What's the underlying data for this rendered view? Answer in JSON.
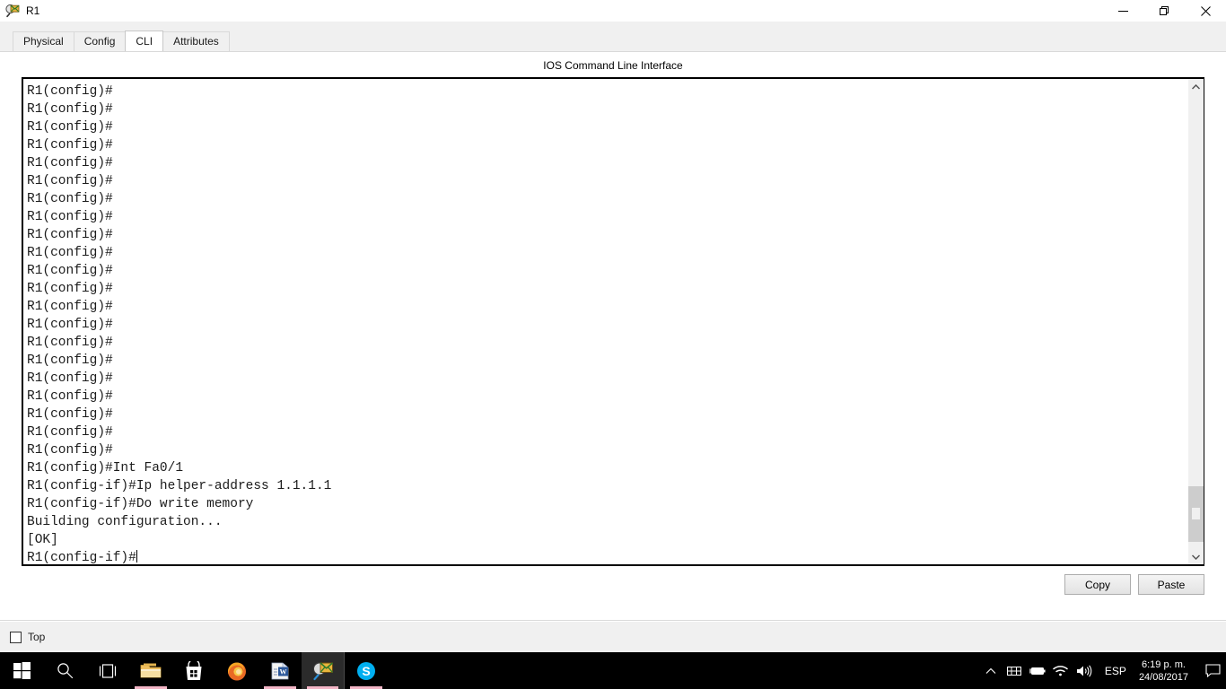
{
  "window": {
    "title": "R1",
    "icon": "packet-tracer-icon",
    "controls": {
      "minimize": "minimize-icon",
      "maximize": "restore-icon",
      "close": "close-icon"
    }
  },
  "tabs": [
    {
      "label": "Physical",
      "active": false
    },
    {
      "label": "Config",
      "active": false
    },
    {
      "label": "CLI",
      "active": true
    },
    {
      "label": "Attributes",
      "active": false
    }
  ],
  "cli": {
    "header": "IOS Command Line Interface",
    "lines": [
      "R1(config)#",
      "R1(config)#",
      "R1(config)#",
      "R1(config)#",
      "R1(config)#",
      "R1(config)#",
      "R1(config)#",
      "R1(config)#",
      "R1(config)#",
      "R1(config)#",
      "R1(config)#",
      "R1(config)#",
      "R1(config)#",
      "R1(config)#",
      "R1(config)#",
      "R1(config)#",
      "R1(config)#",
      "R1(config)#",
      "R1(config)#",
      "R1(config)#",
      "R1(config)#",
      "R1(config)#Int Fa0/1",
      "R1(config-if)#Ip helper-address 1.1.1.1",
      "R1(config-if)#Do write memory",
      "Building configuration...",
      "[OK]"
    ],
    "prompt": "R1(config-if)#",
    "text_color": "#1c1c1c",
    "background": "#ffffff"
  },
  "scrollbar": {
    "up_icon": "chevron-up-icon",
    "down_icon": "chevron-down-icon",
    "thumb_color": "#cdcdcd",
    "track_color": "#f0f0f0"
  },
  "buttons": {
    "copy": "Copy",
    "paste": "Paste"
  },
  "options": {
    "top_label": "Top",
    "top_checked": false
  },
  "taskbar": {
    "items": [
      {
        "name": "start-button",
        "icon": "windows-logo-icon",
        "active": false,
        "underline": false
      },
      {
        "name": "search-button",
        "icon": "search-icon",
        "active": false,
        "underline": false
      },
      {
        "name": "task-view-button",
        "icon": "task-view-icon",
        "active": false,
        "underline": false
      },
      {
        "name": "file-explorer-button",
        "icon": "folder-icon",
        "active": false,
        "underline": true
      },
      {
        "name": "microsoft-store-button",
        "icon": "store-bag-icon",
        "active": false,
        "underline": false
      },
      {
        "name": "firefox-button",
        "icon": "firefox-icon",
        "active": false,
        "underline": false
      },
      {
        "name": "word-button",
        "icon": "word-document-icon",
        "active": false,
        "underline": true
      },
      {
        "name": "packet-tracer-button",
        "icon": "packet-tracer-icon",
        "active": true,
        "underline": true
      },
      {
        "name": "skype-button",
        "icon": "skype-icon",
        "active": false,
        "underline": true
      }
    ],
    "tray": {
      "show_hidden": "chevron-up-icon",
      "icons": [
        {
          "name": "touch-keyboard-icon"
        },
        {
          "name": "battery-icon"
        },
        {
          "name": "wifi-icon"
        },
        {
          "name": "volume-icon"
        }
      ],
      "language": "ESP",
      "time": "6:19 p. m.",
      "date": "24/08/2017",
      "action_center": "notifications-icon"
    }
  },
  "colors": {
    "window_bg": "#ffffff",
    "chrome_bg": "#f0f0f0",
    "taskbar_bg": "#000000",
    "taskbar_underline": "#f3b5c6",
    "terminal_border": "#000000"
  }
}
